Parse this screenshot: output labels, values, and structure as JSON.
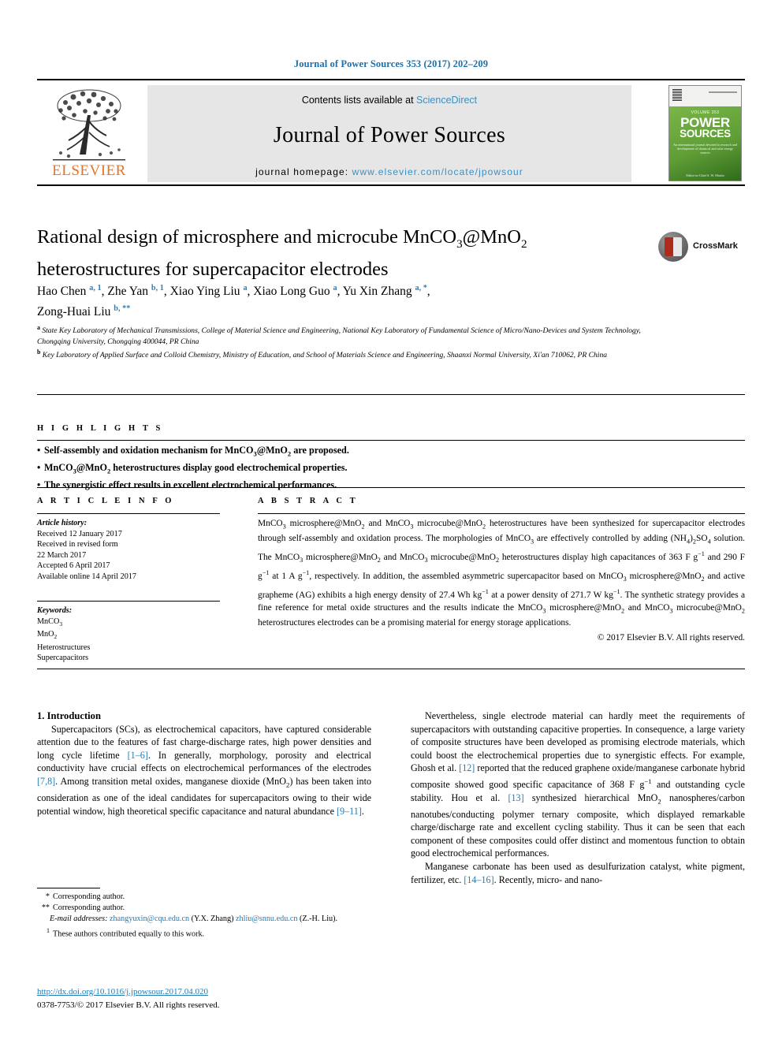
{
  "running_head": "Journal of Power Sources 353 (2017) 202–209",
  "masthead": {
    "publisher": "ELSEVIER",
    "contents_prefix": "Contents lists available at ",
    "contents_link": "ScienceDirect",
    "journal_title": "Journal of Power Sources",
    "homepage_prefix": "journal homepage: ",
    "homepage_url": "www.elsevier.com/locate/jpowsour",
    "cover": {
      "line_small": "VOLUME 353",
      "word1": "POWER",
      "word2": "SOURCES",
      "blurb": "An international journal devoted to research and development of chemical and solar energy sources",
      "foot": "Editor-in-Chief\nS. W. Martin"
    }
  },
  "crossmark": {
    "label": "CrossMark"
  },
  "article": {
    "title_line1_a": "Rational design of microsphere and microcube MnCO",
    "title_line1_sub1": "3",
    "title_line1_b": "@MnO",
    "title_line1_sub2": "2",
    "title_line2": "heterostructures for supercapacitor electrodes",
    "authors": [
      {
        "name": "Hao Chen ",
        "marks": "a, 1",
        "sep": ", "
      },
      {
        "name": "Zhe Yan ",
        "marks": "b, 1",
        "sep": ", "
      },
      {
        "name": "Xiao Ying Liu ",
        "marks": "a",
        "sep": ", "
      },
      {
        "name": "Xiao Long Guo ",
        "marks": "a",
        "sep": ", "
      },
      {
        "name": "Yu Xin Zhang ",
        "marks": "a, *",
        "sep": ", "
      },
      {
        "name": "Zong-Huai Liu ",
        "marks": "b, **",
        "sep": ""
      }
    ],
    "affiliations": [
      {
        "mark": "a",
        "text": "State Key Laboratory of Mechanical Transmissions, College of Material Science and Engineering, National Key Laboratory of Fundamental Science of Micro/Nano-Devices and System Technology, Chongqing University, Chongqing 400044, PR China"
      },
      {
        "mark": "b",
        "text": "Key Laboratory of Applied Surface and Colloid Chemistry, Ministry of Education, and School of Materials Science and Engineering, Shaanxi Normal University, Xi'an 710062, PR China"
      }
    ]
  },
  "highlights": {
    "heading": "H I G H L I G H T S",
    "items": [
      {
        "pre": "Self-assembly and oxidation mechanism for MnCO",
        "s1": "3",
        "mid": "@MnO",
        "s2": "2",
        "post": " are proposed."
      },
      {
        "pre": "MnCO",
        "s1": "3",
        "mid": "@MnO",
        "s2": "2",
        "post": " heterostructures display good electrochemical properties."
      },
      {
        "pre": "The synergistic effect results in excellent electrochemical performances.",
        "s1": "",
        "mid": "",
        "s2": "",
        "post": ""
      }
    ]
  },
  "article_info": {
    "heading": "A R T I C L E   I N F O",
    "history_label": "Article history:",
    "history": [
      "Received 12 January 2017",
      "Received in revised form",
      "22 March 2017",
      "Accepted 6 April 2017",
      "Available online 14 April 2017"
    ],
    "keywords_label": "Keywords:",
    "keywords": [
      {
        "base": "MnCO",
        "sub": "3"
      },
      {
        "base": "MnO",
        "sub": "2"
      },
      {
        "base": "Heterostructures",
        "sub": ""
      },
      {
        "base": "Supercapacitors",
        "sub": ""
      }
    ]
  },
  "abstract": {
    "heading": "A B S T R A C T",
    "segments": [
      {
        "t": "MnCO"
      },
      {
        "sub": "3"
      },
      {
        "t": " microsphere@MnO"
      },
      {
        "sub": "2"
      },
      {
        "t": " and MnCO"
      },
      {
        "sub": "3"
      },
      {
        "t": " microcube@MnO"
      },
      {
        "sub": "2"
      },
      {
        "t": " heterostructures have been synthesized for supercapacitor electrodes through self-assembly and oxidation process. The morphologies of MnCO"
      },
      {
        "sub": "3"
      },
      {
        "t": " are effectively controlled by adding (NH"
      },
      {
        "sub": "4"
      },
      {
        "t": ")"
      },
      {
        "sub": "2"
      },
      {
        "t": "SO"
      },
      {
        "sub": "4"
      },
      {
        "t": " solution. The MnCO"
      },
      {
        "sub": "3"
      },
      {
        "t": " microsphere@MnO"
      },
      {
        "sub": "2"
      },
      {
        "t": " and MnCO"
      },
      {
        "sub": "3"
      },
      {
        "t": " microcube@MnO"
      },
      {
        "sub": "2"
      },
      {
        "t": " heterostructures display high capacitances of 363 F g"
      },
      {
        "sup": "−1"
      },
      {
        "t": " and 290 F g"
      },
      {
        "sup": "−1"
      },
      {
        "t": " at 1 A g"
      },
      {
        "sup": "−1"
      },
      {
        "t": ", respectively. In addition, the assembled asymmetric supercapacitor based on MnCO"
      },
      {
        "sub": "3"
      },
      {
        "t": " microsphere@MnO"
      },
      {
        "sub": "2"
      },
      {
        "t": " and active grapheme (AG) exhibits a high energy density of 27.4 Wh kg"
      },
      {
        "sup": "−1"
      },
      {
        "t": " at a power density of 271.7 W kg"
      },
      {
        "sup": "−1"
      },
      {
        "t": ". The synthetic strategy provides a fine reference for metal oxide structures and the results indicate the MnCO"
      },
      {
        "sub": "3"
      },
      {
        "t": " microsphere@MnO"
      },
      {
        "sub": "2"
      },
      {
        "t": " and MnCO"
      },
      {
        "sub": "3"
      },
      {
        "t": " microcube@MnO"
      },
      {
        "sub": "2"
      },
      {
        "t": " heterostructures electrodes can be a promising material for energy storage applications."
      }
    ],
    "copyright": "© 2017 Elsevier B.V. All rights reserved."
  },
  "body": {
    "section_number_title": "1.  Introduction",
    "left_paragraph_segments": [
      {
        "t": "Supercapacitors (SCs), as electrochemical capacitors, have captured considerable attention due to the features of fast charge-discharge rates, high power densities and long cycle lifetime "
      },
      {
        "ref": "[1–6]"
      },
      {
        "t": ". In generally, morphology, porosity and electrical conductivity have crucial effects on electrochemical performances of the electrodes "
      },
      {
        "ref": "[7,8]"
      },
      {
        "t": ". Among transition metal oxides, manganese dioxide (MnO"
      },
      {
        "sub": "2"
      },
      {
        "t": ") has been taken into consideration as one of the ideal candidates for supercapacitors owing to their wide potential window, high theoretical specific capacitance and natural abundance "
      },
      {
        "ref": "[9–11]"
      },
      {
        "t": "."
      }
    ],
    "right_paragraph1_segments": [
      {
        "t": "Nevertheless, single electrode material can hardly meet the requirements of supercapacitors with outstanding capacitive properties. In consequence, a large variety of composite structures have been developed as promising electrode materials, which could boost the electrochemical properties due to synergistic effects. For example, Ghosh et al. "
      },
      {
        "ref": "[12]"
      },
      {
        "t": " reported that the reduced graphene oxide/manganese carbonate hybrid composite showed good specific capacitance of 368 F g"
      },
      {
        "sup": "−1"
      },
      {
        "t": " and outstanding cycle stability. Hou et al. "
      },
      {
        "ref": "[13]"
      },
      {
        "t": " synthesized hierarchical MnO"
      },
      {
        "sub": "2"
      },
      {
        "t": " nanospheres/carbon nanotubes/conducting polymer ternary composite, which displayed remarkable charge/discharge rate and excellent cycling stability. Thus it can be seen that each component of these composites could offer distinct and momentous function to obtain good electrochemical performances."
      }
    ],
    "right_paragraph2_segments": [
      {
        "t": "Manganese carbonate has been used as desulfurization catalyst, white pigment, fertilizer, etc. "
      },
      {
        "ref": "[14–16]"
      },
      {
        "t": ". Recently, micro- and nano-"
      }
    ]
  },
  "footnotes": {
    "corr1_mark": "*",
    "corr1_text": "Corresponding author.",
    "corr2_mark": "**",
    "corr2_text": "Corresponding author.",
    "email_label": "E-mail addresses:",
    "email1": "zhangyuxin@cqu.edu.cn",
    "email1_owner": "(Y.X. Zhang)",
    "email2": "zhliu@snnu.edu.cn",
    "email2_owner": "(Z.-H. Liu).",
    "equal_mark": "1",
    "equal_text": "These authors contributed equally to this work.",
    "doi": "http://dx.doi.org/10.1016/j.jpowsour.2017.04.020",
    "issn": "0378-7753/© 2017 Elsevier B.V. All rights reserved."
  },
  "colors": {
    "link": "#1f7bb6",
    "sciencedirect": "#3a8fc4",
    "elsevier_orange": "#e87423",
    "cover_green": "#5f9e36"
  }
}
